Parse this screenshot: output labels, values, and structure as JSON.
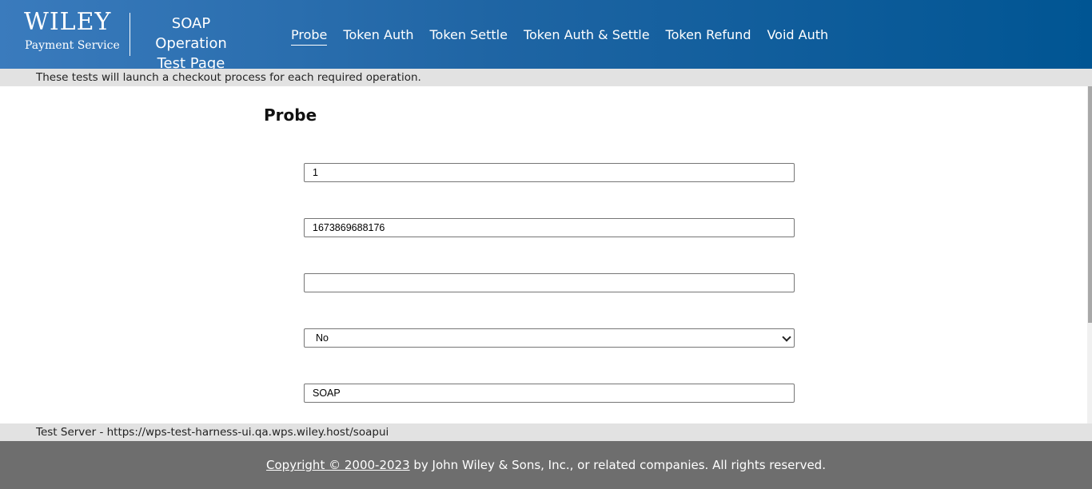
{
  "header": {
    "logo_brand": "WILEY",
    "logo_sub": "Payment Service",
    "app_title_line1": "SOAP Operation",
    "app_title_line2": "Test Page",
    "nav": [
      {
        "label": "Probe",
        "active": true
      },
      {
        "label": "Token Auth"
      },
      {
        "label": "Token Settle"
      },
      {
        "label": "Token Auth & Settle"
      },
      {
        "label": "Token Refund"
      },
      {
        "label": "Void Auth"
      }
    ]
  },
  "info_bar": {
    "text": "These tests will launch a checkout process for each required operation."
  },
  "main": {
    "title": "Probe",
    "fields": {
      "field1_value": "1",
      "field2_value": "1673869688176",
      "field3_value": "",
      "select_value": "No",
      "field5_value": "SOAP"
    }
  },
  "server_bar": {
    "text": "Test Server - https://wps-test-harness-ui.qa.wps.wiley.host/soapui"
  },
  "footer": {
    "copyright_link": "Copyright © 2000-2023",
    "copyright_rest": " by John Wiley & Sons, Inc., or related companies. All rights reserved."
  }
}
